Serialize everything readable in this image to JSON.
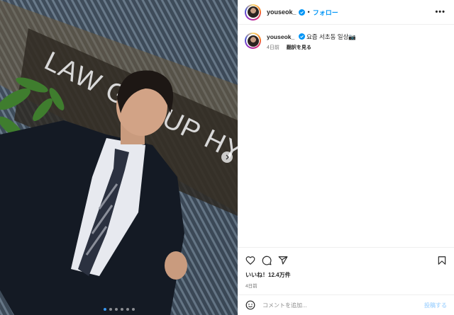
{
  "post": {
    "username": "youseok_",
    "separator": "•",
    "follow_label": "フォロー",
    "more_label": "•••",
    "caption_text": "요즘 서초동 일상📷",
    "caption_age": "4日前",
    "translate_label": "翻訳を見る",
    "likes_text": "いいね！12.4万件",
    "post_date": "4日前",
    "comment_placeholder": "コメントを追加...",
    "submit_label": "投稿する",
    "carousel": {
      "count": 6,
      "active_index": 0
    }
  },
  "photo": {
    "sign_text": "LAW GROUP HYU"
  },
  "icons": {
    "header_more": "more-icon",
    "like": "heart-icon",
    "comment": "comment-icon",
    "share": "share-icon",
    "save": "bookmark-icon",
    "emoji": "emoji-icon",
    "verified": "verified-badge-icon",
    "next": "chevron-right-icon"
  },
  "colors": {
    "link": "#0095f6",
    "verified": "#0095f6",
    "post_disabled": "#b3dbff"
  }
}
